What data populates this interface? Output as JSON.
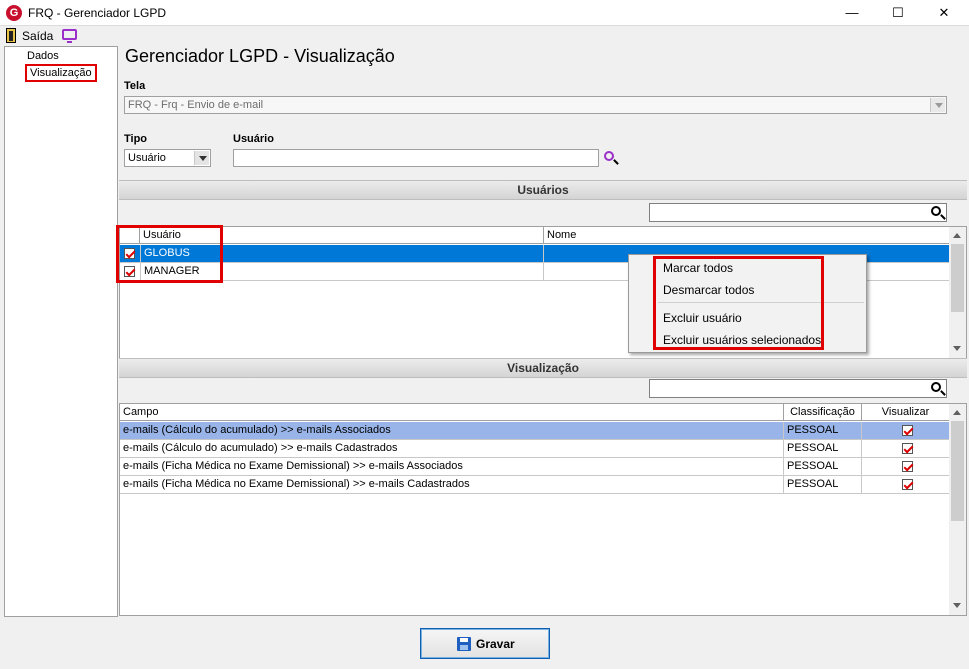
{
  "window": {
    "title": "FRQ - Gerenciador LGPD",
    "logo_letter": "G",
    "minimize_glyph": "—",
    "maximize_glyph": "☐",
    "close_glyph": "✕"
  },
  "menubar": {
    "exit_label": "Saída"
  },
  "icons": {
    "exit": "door-exit-icon",
    "monitor": "monitor-icon",
    "search": "magnifier-icon",
    "save": "floppy-disk-icon"
  },
  "colors": {
    "selected_row": "#0078d7",
    "selected_row_light": "#99b4e8",
    "highlight_red": "#e00000",
    "accent_purple": "#9b2fc9"
  },
  "nav": {
    "items": [
      {
        "label": "Dados"
      },
      {
        "label": "Visualização",
        "active": true
      }
    ]
  },
  "main": {
    "title": "Gerenciador LGPD - Visualização",
    "tela": {
      "label": "Tela",
      "value": "FRQ - Frq - Envio de e-mail"
    },
    "tipo": {
      "label": "Tipo",
      "value": "Usuário"
    },
    "usuario": {
      "label": "Usuário",
      "value": ""
    }
  },
  "usuarios_section": {
    "header": "Usuários",
    "search_value": "",
    "columns": [
      "Usuário",
      "Nome"
    ],
    "rows": [
      {
        "checked": true,
        "usuario": "GLOBUS",
        "nome": "",
        "selected": true
      },
      {
        "checked": true,
        "usuario": "MANAGER",
        "nome": "",
        "selected": false
      }
    ]
  },
  "context_menu": {
    "items": [
      "Marcar todos",
      "Desmarcar todos",
      "Excluir usuário",
      "Excluir usuários selecionados"
    ]
  },
  "visualizacao_section": {
    "header": "Visualização",
    "search_value": "",
    "columns": [
      "Campo",
      "Classificação",
      "Visualizar"
    ],
    "rows": [
      {
        "campo": "e-mails (Cálculo do acumulado) >> e-mails Associados",
        "classificacao": "PESSOAL",
        "visualizar": true,
        "selected": true
      },
      {
        "campo": "e-mails (Cálculo do acumulado) >> e-mails Cadastrados",
        "classificacao": "PESSOAL",
        "visualizar": true,
        "selected": false
      },
      {
        "campo": "e-mails (Ficha Médica no Exame Demissional) >> e-mails Associados",
        "classificacao": "PESSOAL",
        "visualizar": true,
        "selected": false
      },
      {
        "campo": "e-mails (Ficha Médica no Exame Demissional) >> e-mails Cadastrados",
        "classificacao": "PESSOAL",
        "visualizar": true,
        "selected": false
      }
    ]
  },
  "footer": {
    "save_label": "Gravar"
  }
}
